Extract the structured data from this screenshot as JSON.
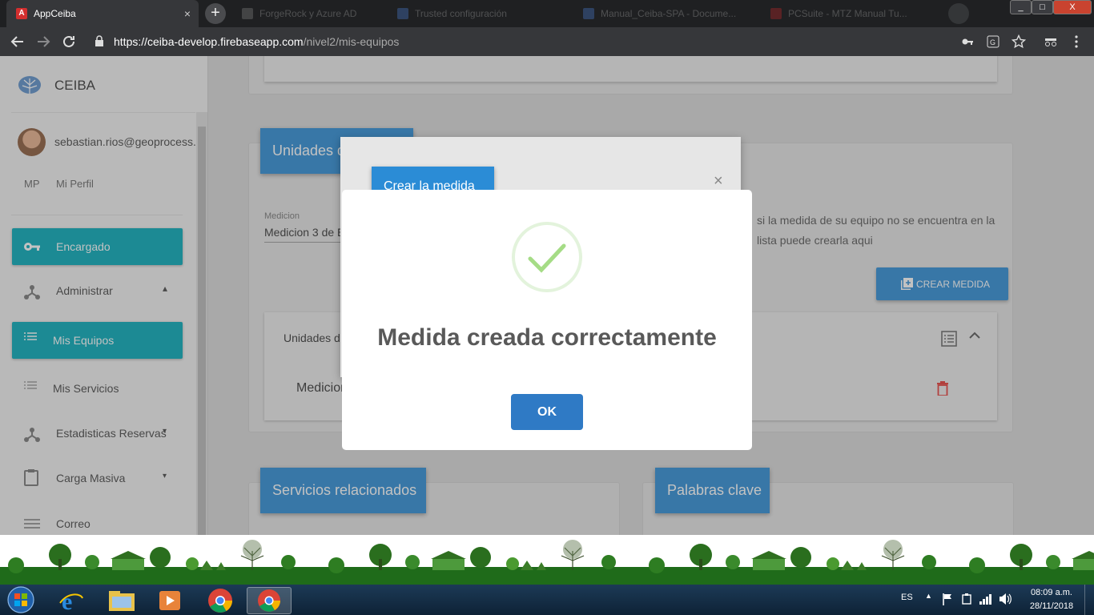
{
  "browser": {
    "active_tab": {
      "title": "AppCeiba",
      "close": "×"
    },
    "background_tabs": [
      {
        "title": "ForgeRock y Azure AD"
      },
      {
        "title": "Trusted configuración"
      },
      {
        "title": "Manual_Ceiba-SPA - Docume..."
      },
      {
        "title": "PCSuite - MTZ Manual Tu..."
      }
    ],
    "new_tab": "+",
    "url_host": "https://ceiba-develop.firebaseapp.com",
    "url_path": "/nivel2/mis-equipos",
    "window_controls": {
      "minimize": "_",
      "maximize": "□",
      "close": "X"
    }
  },
  "sidebar": {
    "brand": "CEIBA",
    "user_email": "sebastian.rios@geoprocess.c",
    "profile_initials": "MP",
    "profile_label": "Mi Perfil",
    "items": [
      {
        "label": "Encargado",
        "icon": "key-icon",
        "active": true
      },
      {
        "label": "Administrar",
        "icon": "hub-icon",
        "expand": "▴"
      },
      {
        "label": "Mis Equipos",
        "icon": "list-icon",
        "active": true
      },
      {
        "label": "Mis Servicios",
        "icon": "list-icon"
      },
      {
        "label": "Estadisticas Reservas",
        "icon": "hub-icon",
        "expand": "▾"
      },
      {
        "label": "Carga Masiva",
        "icon": "clipboard-icon",
        "expand": "▾"
      },
      {
        "label": "Correo",
        "icon": "list-icon"
      }
    ]
  },
  "main": {
    "unidades_header": "Unidades de medida",
    "medicion_label": "Medicion",
    "medicion_value": "Medicion 3 de E",
    "help_text_1": "si la medida de su equipo no se encuentra en la",
    "help_text_2": "lista puede crearla aqui",
    "crear_medida_button": "CREAR MEDIDA",
    "list_title": "Unidades de medida",
    "list_item": "Medicion",
    "servicios_header": "Servicios relacionados",
    "palabras_header": "Palabras clave"
  },
  "modal_behind": {
    "header": "Crear la medida",
    "close": "×"
  },
  "dialog": {
    "title": "Medida creada correctamente",
    "ok_label": "OK"
  },
  "taskbar": {
    "language": "ES",
    "time": "08:09 a.m.",
    "date": "28/11/2018"
  },
  "colors": {
    "accent_teal": "#00a9b8",
    "header_blue": "#2b8cd6",
    "ok_blue": "#2f7ac5",
    "success_green": "#a5dc86",
    "delete_red": "#e53935"
  }
}
